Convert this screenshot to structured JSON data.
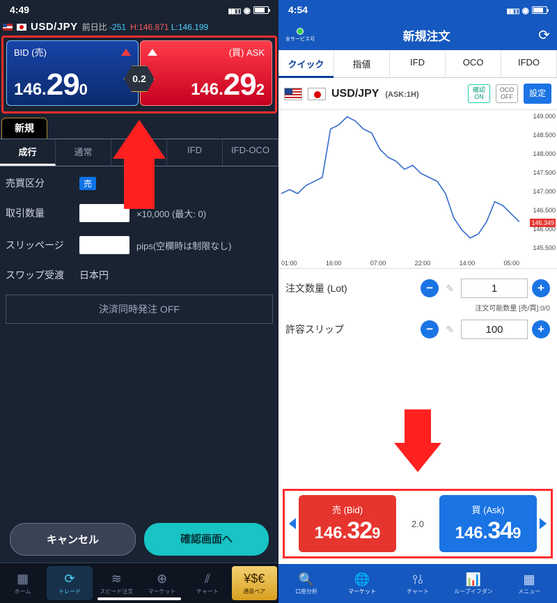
{
  "left": {
    "status": {
      "time": "4:49"
    },
    "pair": "USD/JPY",
    "diff_label": "前日比",
    "diff_value": "-251",
    "high_label": "H:",
    "high": "146.871",
    "low_label": "L:",
    "low": "146.199",
    "bid_label": "BID (売)",
    "ask_label": "(買) ASK",
    "bid": {
      "p1": "146.",
      "p2": "29",
      "p3": "0"
    },
    "ask": {
      "p1": "146.",
      "p2": "29",
      "p3": "2"
    },
    "spread": "0.2",
    "mode_tab": "新規",
    "order_tabs": [
      "成行",
      "通常",
      "",
      "IFD",
      "IFD-OCO"
    ],
    "form": {
      "side_label": "売買区分",
      "side_badge": "売",
      "qty_label": "取引数量",
      "qty_suffix": "×10,000 (最大: 0)",
      "slip_label": "スリッページ",
      "slip_suffix": "pips(空欄時は制限なし)",
      "swap_label": "スワップ受渡",
      "swap_value": "日本円",
      "settle_off": "決済同時発注 OFF"
    },
    "buttons": {
      "cancel": "キャンセル",
      "confirm": "確認画面へ"
    },
    "nav": [
      "ホーム",
      "トレード",
      "スピード注文",
      "マーケット",
      "チャート",
      "通貨ペア"
    ]
  },
  "right": {
    "status": {
      "time": "4:54"
    },
    "status_label": "全サービス可",
    "title": "新規注文",
    "tabs": [
      "クイック",
      "指値",
      "IFD",
      "OCO",
      "IFDO"
    ],
    "pair": "USD/JPY",
    "tf": "(ASK:1H)",
    "chip_on": "確認\nON",
    "chip_off": "OCO\nOFF",
    "chip_set": "設定",
    "form": {
      "qty_label": "注文数量 (Lot)",
      "qty_value": "1",
      "qty_note": "注文可能数量 [売/買]:0/0",
      "slip_label": "許容スリップ",
      "slip_value": "100"
    },
    "bid_label": "売 (Bid)",
    "ask_label": "買 (Ask)",
    "bid": {
      "p1": "146.",
      "p2": "32",
      "p3": "9"
    },
    "ask": {
      "p1": "146.",
      "p2": "34",
      "p3": "9"
    },
    "spread": "2.0",
    "nav": [
      "口座分析",
      "マーケット",
      "チャート",
      "ループイフダン",
      "メニュー"
    ]
  },
  "chart_data": {
    "type": "line",
    "title": "",
    "xlabel": "",
    "ylabel": "",
    "ylim": [
      145.5,
      149.0
    ],
    "y_ticks": [
      149.0,
      148.5,
      148.0,
      147.5,
      147.0,
      146.5,
      146.0,
      145.5
    ],
    "last_price": 146.349,
    "x_ticks": [
      "01:00",
      "16:00",
      "07:00",
      "22:00",
      "14:00",
      "05:00"
    ],
    "series": [
      {
        "name": "ASK",
        "x": [
          0,
          1,
          2,
          3,
          4,
          5,
          6,
          7,
          8,
          9,
          10,
          11,
          12,
          13,
          14,
          15,
          16,
          17,
          18,
          19,
          20,
          21,
          22,
          23,
          24,
          25,
          26,
          27,
          28,
          29
        ],
        "values": [
          147.0,
          147.1,
          147.0,
          147.2,
          147.3,
          147.4,
          148.6,
          148.7,
          148.9,
          148.8,
          148.6,
          148.5,
          148.1,
          147.9,
          147.8,
          147.6,
          147.7,
          147.5,
          147.4,
          147.3,
          147.0,
          146.4,
          146.1,
          145.9,
          146.0,
          146.3,
          146.8,
          146.7,
          146.5,
          146.3
        ]
      }
    ]
  }
}
